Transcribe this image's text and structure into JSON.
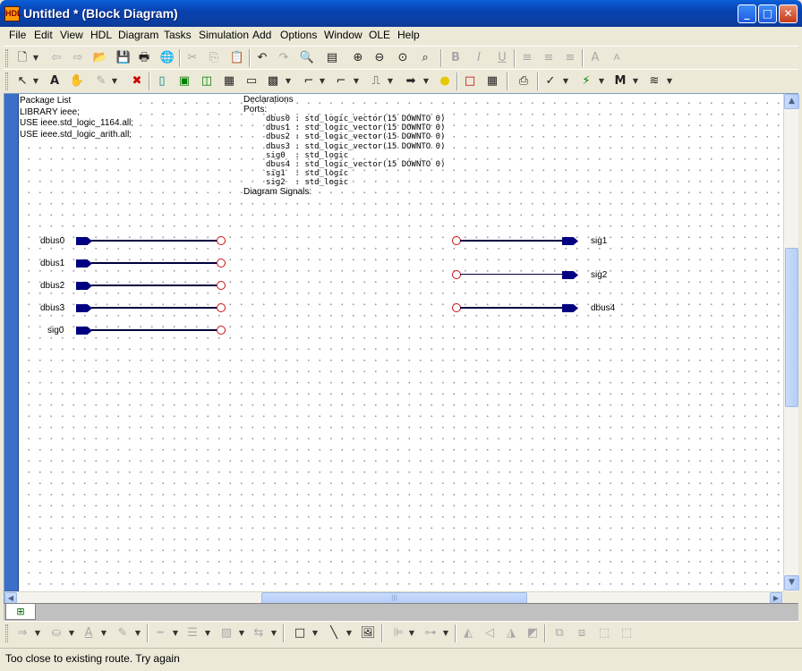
{
  "window": {
    "title": "Untitled * (Block Diagram)",
    "icon": "HDL"
  },
  "controls": {
    "minimize": "_",
    "maximize": "□",
    "close": "✕"
  },
  "menu": [
    "File",
    "Edit",
    "View",
    "HDL",
    "Diagram",
    "Tasks",
    "Simulation",
    "Add",
    "Options",
    "Window",
    "OLE",
    "Help"
  ],
  "package": {
    "header": "Package List",
    "lines": [
      "LIBRARY ieee;",
      "USE ieee.std_logic_1164.all;",
      "USE ieee.std_logic_arith.all;"
    ]
  },
  "declarations": {
    "header": "Declarations",
    "ports_label": "Ports:",
    "ports": [
      "dbus0 : std_logic_vector(15 DOWNTO 0)",
      "dbus1 : std_logic_vector(15 DOWNTO 0)",
      "dbus2 : std_logic_vector(15 DOWNTO 0)",
      "dbus3 : std_logic_vector(15 DOWNTO 0)",
      "sig0  : std_logic",
      "dbus4 : std_logic_vector(15 DOWNTO 0)",
      "sig1  : std_logic",
      "sig2  : std_logic"
    ],
    "signals_label": "Diagram Signals:"
  },
  "input_ports": [
    "dbus0",
    "dbus1",
    "dbus2",
    "dbus3",
    "sig0"
  ],
  "output_ports": [
    "sig1",
    "sig2",
    "dbus4"
  ],
  "tab": {
    "icon": "block-diagram-icon",
    "glyph": "⊞"
  },
  "status": {
    "message": "Too close to existing route. Try again"
  },
  "colors": {
    "port": "#000080",
    "connector": "#cc1010",
    "title_bar": "#0842b0",
    "ruler": "#3b6fc8"
  }
}
